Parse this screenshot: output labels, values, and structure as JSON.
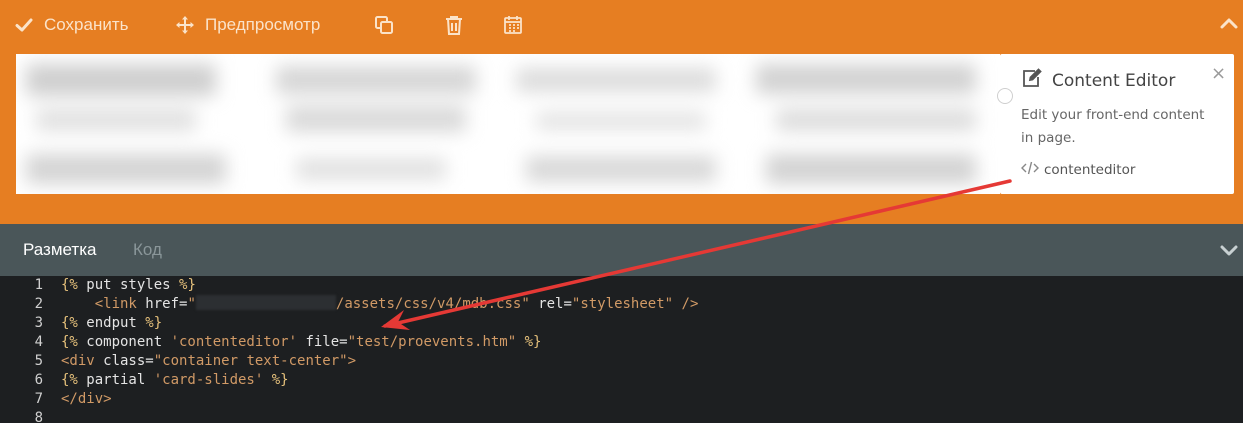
{
  "toolbar": {
    "save_label": "Сохранить",
    "preview_label": "Предпросмотр",
    "icons": [
      "check-icon",
      "move-icon",
      "copy-icon",
      "trash-icon",
      "calendar-icon",
      "chevron-up-icon"
    ]
  },
  "popover": {
    "title": "Content Editor",
    "close": "×",
    "description": "Edit your front-end content in page.",
    "code": "contenteditor"
  },
  "tabs": [
    {
      "label": "Разметка",
      "active": true
    },
    {
      "label": "Код",
      "active": false
    }
  ],
  "editor": {
    "line_numbers": [
      "1",
      "2",
      "3",
      "4",
      "5",
      "6",
      "7",
      "8"
    ]
  },
  "colors": {
    "toolbar_bg": "#e67e22",
    "tabs_bg": "#4a5659",
    "editor_bg": "#1d1f21",
    "arrow": "#e53935"
  }
}
